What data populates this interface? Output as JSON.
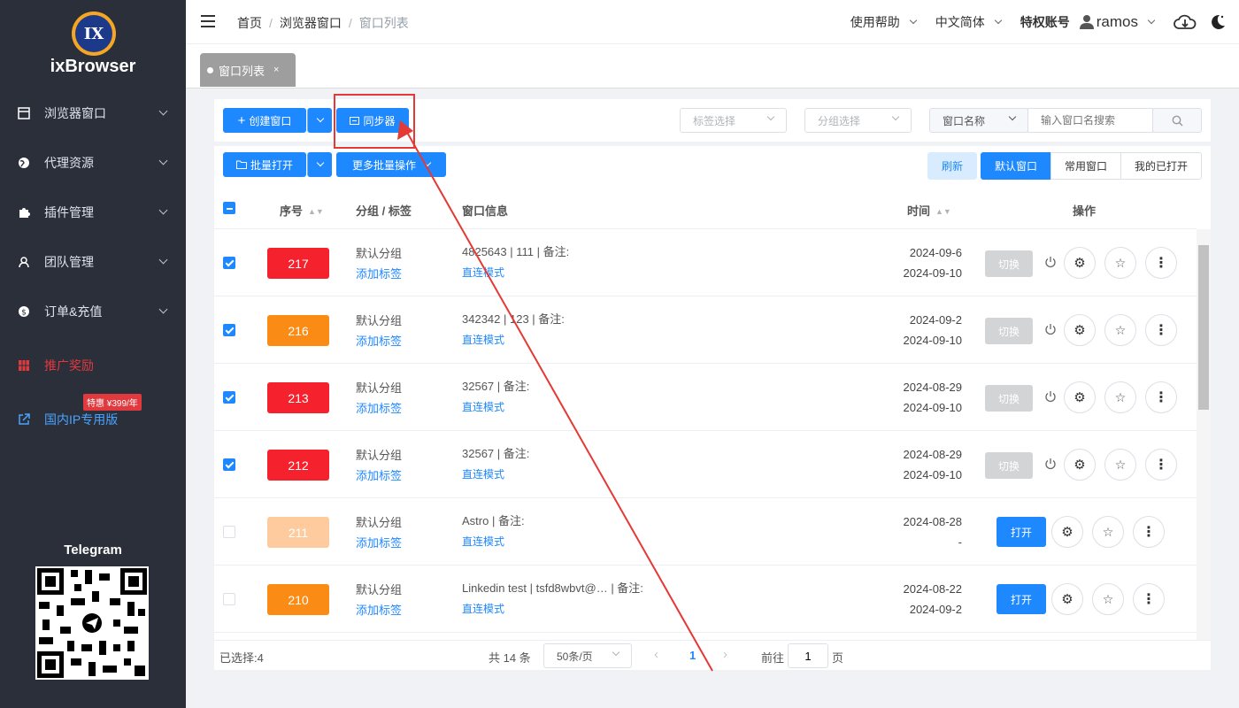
{
  "brand": "ixBrowser",
  "logo_text": "IX",
  "sidebar": {
    "items": [
      {
        "label": "浏览器窗口",
        "icon": "window-icon"
      },
      {
        "label": "代理资源",
        "icon": "globe-icon"
      },
      {
        "label": "插件管理",
        "icon": "puzzle-icon"
      },
      {
        "label": "团队管理",
        "icon": "team-icon"
      },
      {
        "label": "订单&充值",
        "icon": "dollar-icon"
      },
      {
        "label": "推广奖励",
        "icon": "gift-icon"
      },
      {
        "label": "国内IP专用版",
        "icon": "external-link-icon"
      }
    ],
    "sale_badge": "特惠 ¥399/年",
    "telegram": "Telegram"
  },
  "breadcrumb": [
    "首页",
    "浏览器窗口",
    "窗口列表"
  ],
  "topbar": {
    "help": "使用帮助",
    "lang": "中文简体",
    "account_label": "特权账号",
    "user": "ramos"
  },
  "tabs": [
    {
      "label": "窗口列表",
      "close": "×"
    }
  ],
  "toolbar": {
    "create": "创建窗口",
    "sync": "同步器",
    "tag_select": "标签选择",
    "group_select": "分组选择",
    "search_field": "窗口名称",
    "search_placeholder": "输入窗口名搜索"
  },
  "toolbar2": {
    "batch_open": "批量打开",
    "more_batch": "更多批量操作",
    "refresh": "刷新",
    "seg": [
      "默认窗口",
      "常用窗口",
      "我的已打开"
    ]
  },
  "table": {
    "headers": {
      "no": "序号",
      "group": "分组 / 标签",
      "info": "窗口信息",
      "time": "时间",
      "ops": "操作"
    },
    "rows": [
      {
        "checked": true,
        "no": "217",
        "color": "#f5222d",
        "group": "默认分组",
        "tag": "添加标签",
        "info": "4825643 | 111 | 备注:",
        "mode": "直连模式",
        "t1": "2024-09-6",
        "t2": "2024-09-10",
        "action": "切换",
        "opened": true
      },
      {
        "checked": true,
        "no": "216",
        "color": "#fa8c16",
        "group": "默认分组",
        "tag": "添加标签",
        "info": "342342 | 123 | 备注:",
        "mode": "直连模式",
        "t1": "2024-09-2",
        "t2": "2024-09-10",
        "action": "切换",
        "opened": true
      },
      {
        "checked": true,
        "no": "213",
        "color": "#f5222d",
        "group": "默认分组",
        "tag": "添加标签",
        "info": "32567 | 备注:",
        "mode": "直连模式",
        "t1": "2024-08-29",
        "t2": "2024-09-10",
        "action": "切换",
        "opened": true
      },
      {
        "checked": true,
        "no": "212",
        "color": "#f5222d",
        "group": "默认分组",
        "tag": "添加标签",
        "info": "32567 | 备注:",
        "mode": "直连模式",
        "t1": "2024-08-29",
        "t2": "2024-09-10",
        "action": "切换",
        "opened": true
      },
      {
        "checked": false,
        "no": "211",
        "color": "#fdcb9e",
        "group": "默认分组",
        "tag": "添加标签",
        "info": "Astro | 备注:",
        "mode": "直连模式",
        "t1": "2024-08-28",
        "t2": "-",
        "action": "打开",
        "opened": false
      },
      {
        "checked": false,
        "no": "210",
        "color": "#fa8c16",
        "group": "默认分组",
        "tag": "添加标签",
        "info": "Linkedin test | tsfd8wbvt@… | 备注:",
        "mode": "直连模式",
        "t1": "2024-08-22",
        "t2": "2024-09-2",
        "action": "打开",
        "opened": false
      }
    ]
  },
  "footer": {
    "selected": "已选择:4",
    "total": "共 14 条",
    "page_size": "50条/页",
    "page": "1",
    "goto_label": "前往",
    "goto_value": "1",
    "page_unit": "页"
  }
}
